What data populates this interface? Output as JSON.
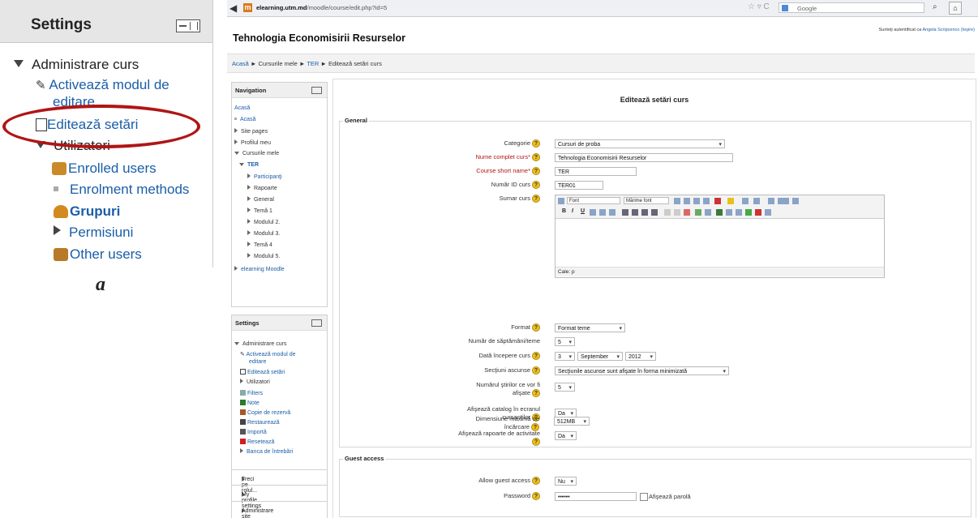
{
  "zoom_panel": {
    "title": "Settings",
    "items": {
      "administrare": "Administrare curs",
      "activeaza_1": "Activează modul de",
      "activeaza_2": "editare",
      "editeaza": "Editează setări",
      "utilizatori": "Utilizatori",
      "enrolled": "Enrolled users",
      "enrolment": "Enrolment methods",
      "grupuri": "Grupuri",
      "permisiuni": "Permisiuni",
      "other": "Other users"
    },
    "caption": "a",
    "highlight_color": "#b01515"
  },
  "browser": {
    "url_domain": "elearning.utm.md",
    "url_path": "/moodle/course/edit.php?id=5",
    "search_placeholder": "Google",
    "favicon": "m"
  },
  "header": {
    "title": "Tehnologia Economisirii Resurselor",
    "login_prefix": "Sunteţi autentificat ca",
    "login_user": "Angela Scripcenco",
    "logout": "(Ieşire)"
  },
  "breadcrumb": {
    "home": "Acasă",
    "sep": "►",
    "courses": "Cursurile mele",
    "course": "TER",
    "current": "Editează setări curs"
  },
  "navigation": {
    "title": "Navigation",
    "home": "Acasă",
    "home2": "Acasă",
    "site_pages": "Site pages",
    "profile": "Profilul meu",
    "my_courses": "Cursurile mele",
    "course": "TER",
    "participants": "Participanţi",
    "reports": "Rapoarte",
    "general": "General",
    "tema1": "Temă 1",
    "modul2": "Modulul 2.",
    "modul3": "Modulul 3.",
    "tema4": "Temă 4",
    "modul5": "Modulul 5.",
    "elearning": "elearning Moodle"
  },
  "settings_block": {
    "title": "Settings",
    "administrare": "Administrare curs",
    "activeaza_1": "Activează modul de",
    "activeaza_2": "editare",
    "editeaza": "Editează setări",
    "utilizatori": "Utilizatori",
    "filters": "Filters",
    "note": "Note",
    "copie": "Copie de rezervă",
    "restaureaza": "Restaurează",
    "importa": "Importă",
    "reseteaza": "Resetează",
    "banca": "Banca de întrebări",
    "treci": "Treci pe rolul...",
    "profile_settings": "My profile settings",
    "admin_site": "Administrare site"
  },
  "form": {
    "title": "Editează setări curs",
    "general_legend": "General",
    "guest_legend": "Guest access",
    "help_glyph": "?",
    "labels": {
      "categorie": "Categorie",
      "nume": "Nume complet curs*",
      "short": "Course short name*",
      "id": "Număr ID curs",
      "sumar": "Sumar curs",
      "format": "Format",
      "saptamani": "Număr de săptămâni/teme",
      "data": "Dată începere curs",
      "sectiuni": "Secţiuni ascunse",
      "stiri_1": "Numărul ştirilor ce vor fi",
      "stiri_2": "afişate",
      "catalog_1": "Afişează catalog în ecranul",
      "catalog_2": "cursanţilor",
      "rapoarte_1": "Afişează rapoarte de activitate",
      "dimensiune_1": "Dimensiune maximă de",
      "dimensiune_2": "încărcare",
      "allow_guest": "Allow guest access",
      "password": "Password"
    },
    "values": {
      "categorie": "Cursuri de proba",
      "nume": "Tehnologia Economisirii Resurselor",
      "short": "TER",
      "id": "TER01",
      "format": "Format teme",
      "saptamani": "5",
      "zi": "3",
      "luna": "September",
      "an": "2012",
      "sectiuni": "Secţiunile ascunse sunt afişate în forma minimizată",
      "stiri": "5",
      "catalog": "Da",
      "rapoarte": "Da",
      "dimensiune": "512MB",
      "allow_guest": "Nu",
      "password": "••••••",
      "show_password": "Afişează parolă"
    },
    "editor": {
      "font": "Font",
      "size": "Mărime font",
      "path": "Cale: p"
    }
  }
}
